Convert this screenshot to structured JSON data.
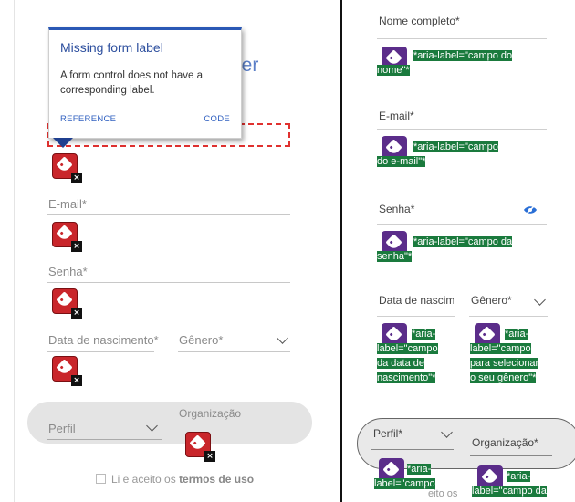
{
  "left_form": {
    "heading_partial": "ler",
    "email_label": "E-mail*",
    "password_label": "Senha*",
    "birthdate_label": "Data de nascimento*",
    "gender_label": "Gênero*",
    "profile_label": "Perfil",
    "organization_label": "Organização",
    "terms_prefix": "Li e aceito os",
    "terms_link": "termos de uso"
  },
  "tooltip": {
    "title": "Missing form label",
    "body": "A form control does not have a corresponding label.",
    "reference_link": "REFERENCE",
    "code_link": "CODE"
  },
  "right_form": {
    "fullname_label": "Nome completo*",
    "fullname_aria": "*aria-label=\"campo do nome\"*",
    "email_label": "E-mail*",
    "email_aria": "*aria-label=\"campo do e-mail\"*",
    "password_label": "Senha*",
    "password_aria": "*aria-label=\"campo da senha\"*",
    "birthdate_label": "Data de nascime",
    "birthdate_aria": "*aria-label=\"campo da data de nascimento\"*",
    "gender_label": "Gênero*",
    "gender_aria": "*aria-label=\"campo para selecionar o seu gênero\"*",
    "profile_label": "Perfil*",
    "organization_label": "Organização*",
    "profile_aria": "*aria-label=\"campo",
    "organization_aria": "*aria-label=\"campo da",
    "terms_partial": "eito os"
  },
  "colors": {
    "error_badge": "#c9262b",
    "aria_badge": "#5b2d8a",
    "aria_highlight": "#1a7a3d",
    "tooltip_accent": "#2a58b5",
    "focus_outline": "#e0312f"
  }
}
